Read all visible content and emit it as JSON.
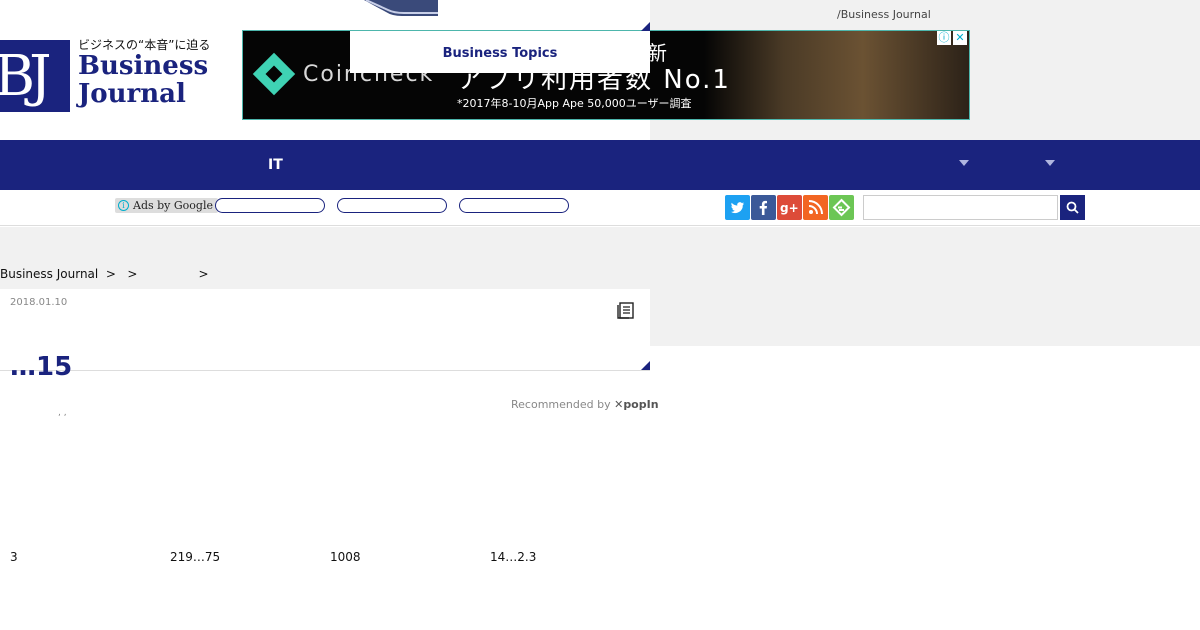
{
  "header": {
    "tagline": "/Business Journal",
    "logo": {
      "mark": "BJ",
      "subtitle": "ビジネスの“本音”に迫る",
      "line1": "Business",
      "line2": "Journal"
    },
    "topics_tab": "Business Topics"
  },
  "ad_banner": {
    "brand": "Coincheck",
    "headline_fragment": "新",
    "headline": "アプリ利用者数 No.1",
    "note": "*2017年8-10月App Ape 50,000ユーザー調査",
    "accent_color": "#3fd2b4"
  },
  "nav": {
    "item_it": "IT",
    "background": "#1a237e"
  },
  "subbar": {
    "ads_by_google": "Ads by Google",
    "social_icons": [
      "twitter-icon",
      "facebook-icon",
      "google-plus-icon",
      "rss-icon",
      "feedly-icon"
    ]
  },
  "breadcrumb": {
    "home": "Business Journal",
    "sep1": ">",
    "sep2": ">",
    "sep3": ">"
  },
  "article": {
    "date": "2018.01.10",
    "title": "…15",
    "tags_punct": ", ,"
  },
  "recommend": {
    "label": "Recommended by",
    "brand": "popIn"
  },
  "stats": [
    "3",
    "219…75",
    "1008",
    "14…2.3"
  ]
}
